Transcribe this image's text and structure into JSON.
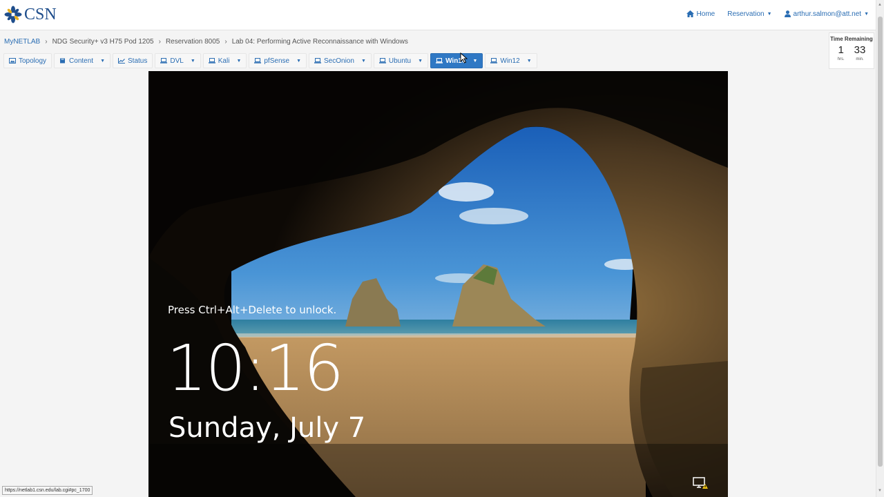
{
  "header": {
    "logo_text": "CSN",
    "nav": [
      {
        "label": "Home",
        "icon": "home-icon"
      },
      {
        "label": "Reservation",
        "icon": null
      },
      {
        "label": "arthur.salmon@att.net",
        "icon": "user-icon"
      }
    ]
  },
  "breadcrumb": {
    "items": [
      "MyNETLAB",
      "NDG Security+ v3 H75 Pod 1205",
      "Reservation 8005",
      "Lab 04: Performing Active Reconnaissance with Windows"
    ]
  },
  "timer": {
    "title": "Time Remaining",
    "hours": "1",
    "hours_unit": "hrs.",
    "minutes": "33",
    "minutes_unit": "min."
  },
  "tabs": [
    {
      "label": "Topology",
      "icon": "image-icon",
      "dropdown": false,
      "active": false
    },
    {
      "label": "Content",
      "icon": "book-icon",
      "dropdown": true,
      "active": false
    },
    {
      "label": "Status",
      "icon": "chart-icon",
      "dropdown": false,
      "active": false
    },
    {
      "label": "DVL",
      "icon": "laptop-icon",
      "dropdown": true,
      "active": false
    },
    {
      "label": "Kali",
      "icon": "laptop-icon",
      "dropdown": true,
      "active": false
    },
    {
      "label": "pfSense",
      "icon": "laptop-icon",
      "dropdown": true,
      "active": false
    },
    {
      "label": "SecOnion",
      "icon": "laptop-icon",
      "dropdown": true,
      "active": false
    },
    {
      "label": "Ubuntu",
      "icon": "laptop-icon",
      "dropdown": true,
      "active": false
    },
    {
      "label": "Win16",
      "icon": "laptop-icon",
      "dropdown": true,
      "active": true
    },
    {
      "label": "Win12",
      "icon": "laptop-icon",
      "dropdown": true,
      "active": false
    }
  ],
  "vm_screen": {
    "hint": "Press Ctrl+Alt+Delete to unlock.",
    "time": "10:16",
    "date": "Sunday, July 7"
  },
  "status_url": "https://netlab1.csn.edu/lab.cgi#pc_1700",
  "colors": {
    "link": "#2a6db3",
    "active_tab": "#2f78c4",
    "brand": "#1f4e8c"
  }
}
